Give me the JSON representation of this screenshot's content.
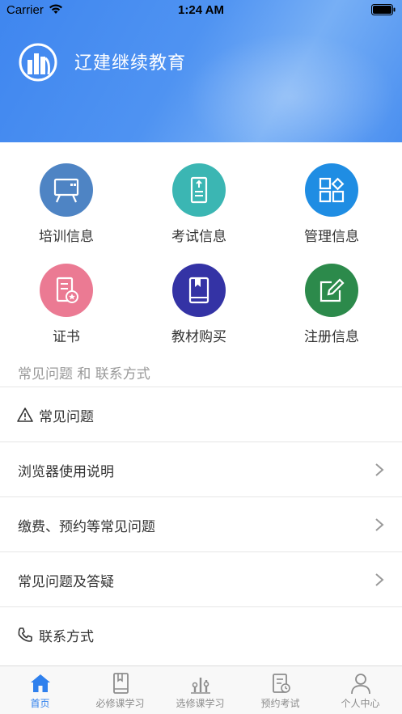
{
  "status_bar": {
    "carrier": "Carrier",
    "time": "1:24 AM"
  },
  "header": {
    "app_title": "辽建继续教育"
  },
  "grid": [
    {
      "label": "培训信息",
      "icon": "presentation-board-icon",
      "color": "#4e84c4"
    },
    {
      "label": "考试信息",
      "icon": "exam-paper-icon",
      "color": "#3bb6b3"
    },
    {
      "label": "管理信息",
      "icon": "management-grid-icon",
      "color": "#1f8de3"
    },
    {
      "label": "证书",
      "icon": "certificate-icon",
      "color": "#eb7a93"
    },
    {
      "label": "教材购买",
      "icon": "book-icon",
      "color": "#3433a5"
    },
    {
      "label": "注册信息",
      "icon": "edit-form-icon",
      "color": "#2c8a4b"
    }
  ],
  "faq": {
    "section_title": "常见问题 和 联系方式",
    "faq_header": "常见问题",
    "items": [
      {
        "label": "浏览器使用说明"
      },
      {
        "label": "缴费、预约等常见问题"
      },
      {
        "label": "常见问题及答疑"
      }
    ],
    "contact_header": "联系方式"
  },
  "tabbar": [
    {
      "label": "首页",
      "icon": "home-icon",
      "active": true
    },
    {
      "label": "必修课学习",
      "icon": "required-course-icon",
      "active": false
    },
    {
      "label": "选修课学习",
      "icon": "elective-course-icon",
      "active": false
    },
    {
      "label": "预约考试",
      "icon": "exam-booking-icon",
      "active": false
    },
    {
      "label": "个人中心",
      "icon": "profile-icon",
      "active": false
    }
  ],
  "colors": {
    "accent": "#2f80ed",
    "header_start": "#3f86ef",
    "inactive": "#8c8c8c"
  }
}
